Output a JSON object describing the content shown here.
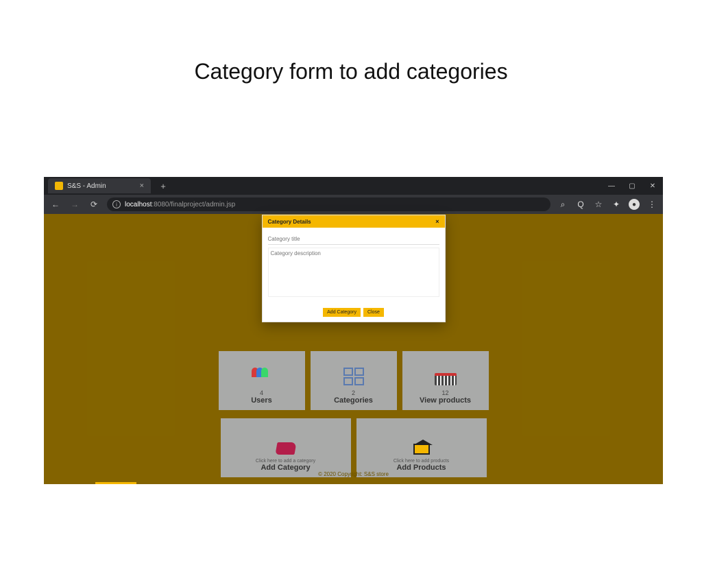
{
  "slide_title": "Category form to add categories",
  "browser": {
    "tab_title": "S&S - Admin",
    "url_host": "localhost",
    "url_path": ":8080/finalproject/admin.jsp"
  },
  "modal": {
    "title": "Category Details",
    "title_placeholder": "Category title",
    "desc_placeholder": "Category description",
    "add_label": "Add Category",
    "close_label": "Close"
  },
  "cards": {
    "users": {
      "count": "4",
      "label": "Users"
    },
    "categories": {
      "count": "2",
      "label": "Categories"
    },
    "products": {
      "count": "12",
      "label": "View products"
    },
    "add_category": {
      "sub": "Click here to add a category",
      "label": "Add Category"
    },
    "add_products": {
      "sub": "Click here to add products",
      "label": "Add Products"
    }
  },
  "footer": "© 2020 Copyright: S&S store"
}
